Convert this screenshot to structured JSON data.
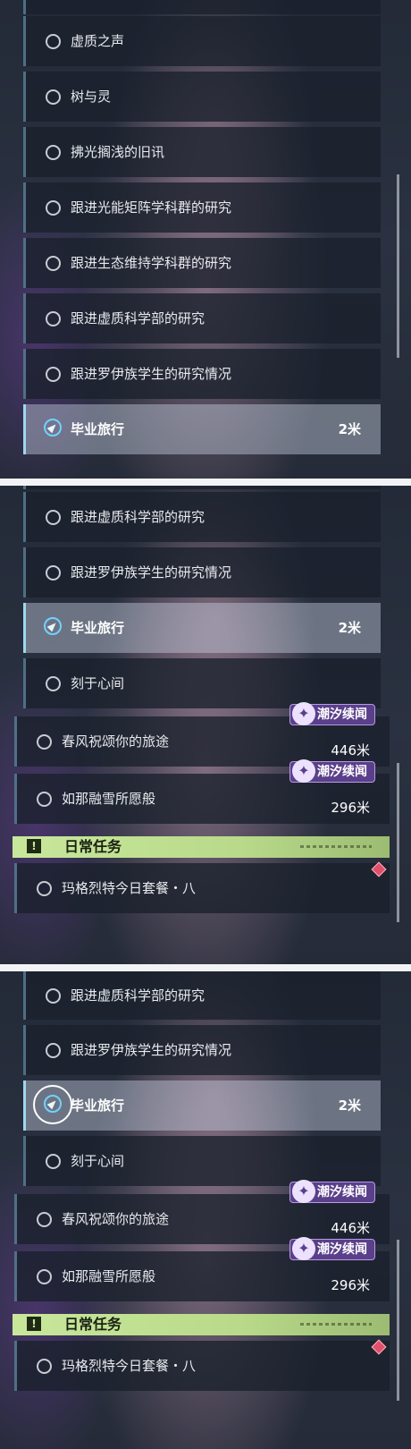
{
  "screens": [
    {
      "rows": [
        {
          "label": "虚质之声"
        },
        {
          "label": "树与灵"
        },
        {
          "label": "拂光搁浅的旧讯"
        },
        {
          "label": "跟进光能矩阵学科群的研究"
        },
        {
          "label": "跟进生态维持学科群的研究"
        },
        {
          "label": "跟进虚质科学部的研究"
        },
        {
          "label": "跟进罗伊族学生的研究情况"
        }
      ],
      "active": {
        "label": "毕业旅行",
        "distance": "2米"
      }
    },
    {
      "rows_before": [
        {
          "label": "跟进虚质科学部的研究"
        },
        {
          "label": "跟进罗伊族学生的研究情况"
        }
      ],
      "active": {
        "label": "毕业旅行",
        "distance": "2米"
      },
      "row_after": {
        "label": "刻于心间"
      },
      "event_rows": [
        {
          "label": "春风祝颂你的旅途",
          "distance": "446米",
          "badge": "潮汐续闻"
        },
        {
          "label": "如那融雪所愿般",
          "distance": "296米",
          "badge": "潮汐续闻"
        }
      ],
      "daily_header": "日常任务",
      "daily_icon": "!",
      "daily_row": {
        "label": "玛格烈特今日套餐・八"
      }
    },
    {
      "rows_before": [
        {
          "label": "跟进虚质科学部的研究"
        },
        {
          "label": "跟进罗伊族学生的研究情况"
        }
      ],
      "active": {
        "label": "毕业旅行",
        "distance": "2米"
      },
      "row_after": {
        "label": "刻于心间"
      },
      "event_rows": [
        {
          "label": "春风祝颂你的旅途",
          "distance": "446米",
          "badge": "潮汐续闻"
        },
        {
          "label": "如那融雪所愿般",
          "distance": "296米",
          "badge": "潮汐续闻"
        }
      ],
      "daily_header": "日常任务",
      "daily_icon": "!",
      "daily_row": {
        "label": "玛格烈特今日套餐・八"
      }
    }
  ],
  "icons": {
    "quest_circle": "circle-icon",
    "tracked": "compass-icon",
    "event": "tidal-event-icon",
    "daily": "exclamation-icon",
    "alert": "diamond-icon"
  },
  "colors": {
    "active_accent": "#9fd6ef",
    "badge_bg": "#5a3f8a",
    "daily_bg": "#c8e79b",
    "alert": "#e0506a"
  }
}
